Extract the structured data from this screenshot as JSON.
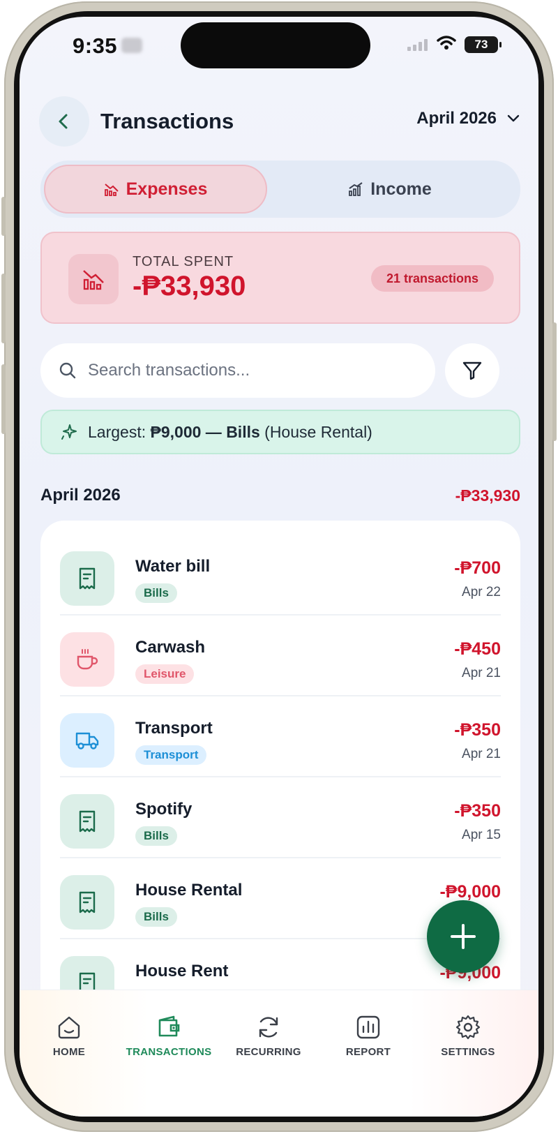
{
  "status_bar": {
    "time": "9:35",
    "battery": "73"
  },
  "header": {
    "title": "Transactions",
    "month": "April 2026"
  },
  "segments": {
    "expenses": "Expenses",
    "income": "Income"
  },
  "summary": {
    "label": "TOTAL SPENT",
    "amount": "-₱33,930",
    "count": "21 transactions"
  },
  "search": {
    "placeholder": "Search transactions..."
  },
  "insight": {
    "prefix": "Largest:",
    "amount": "₱9,000",
    "separator": "—",
    "category": "Bills",
    "detail": "(House Rental)"
  },
  "section": {
    "month": "April 2026",
    "total": "-₱33,930"
  },
  "transactions": [
    {
      "name": "Water bill",
      "category": "Bills",
      "amount": "-₱700",
      "date": "Apr 22",
      "icon": "receipt-icon"
    },
    {
      "name": "Carwash",
      "category": "Leisure",
      "amount": "-₱450",
      "date": "Apr 21",
      "icon": "coffee-icon"
    },
    {
      "name": "Transport",
      "category": "Transport",
      "amount": "-₱350",
      "date": "Apr 21",
      "icon": "truck-icon"
    },
    {
      "name": "Spotify",
      "category": "Bills",
      "amount": "-₱350",
      "date": "Apr 15",
      "icon": "receipt-icon"
    },
    {
      "name": "House Rental",
      "category": "Bills",
      "amount": "-₱9,000",
      "date": "",
      "icon": "receipt-icon"
    },
    {
      "name": "House Rent",
      "category": "",
      "amount": "-₱9,000",
      "date": "",
      "icon": "receipt-icon"
    }
  ],
  "tabs": [
    {
      "label": "HOME",
      "icon": "home-icon"
    },
    {
      "label": "TRANSACTIONS",
      "icon": "wallet-icon",
      "active": true
    },
    {
      "label": "RECURRING",
      "icon": "refresh-icon"
    },
    {
      "label": "REPORT",
      "icon": "bar-chart-icon"
    },
    {
      "label": "SETTINGS",
      "icon": "gear-icon"
    }
  ],
  "colors": {
    "expense_red": "#d0142c",
    "brand_green": "#0f6b44",
    "bills_green": "#1b6b4b",
    "leisure_pink": "#e0566a",
    "transport_blue": "#1d8fd6"
  }
}
